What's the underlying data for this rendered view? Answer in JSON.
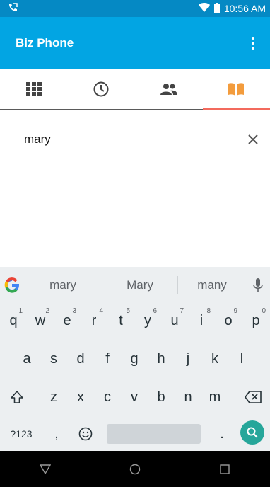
{
  "status": {
    "time": "10:56 AM"
  },
  "app": {
    "title": "Biz Phone"
  },
  "tabs": [
    {
      "icon": "dialpad-icon"
    },
    {
      "icon": "recent-clock-icon"
    },
    {
      "icon": "contacts-icon"
    },
    {
      "icon": "phonebook-icon",
      "active": true,
      "active_color": "#F36A5D"
    }
  ],
  "search": {
    "value": "mary"
  },
  "keyboard": {
    "suggestions": [
      "mary",
      "Mary",
      "many"
    ],
    "row1": [
      {
        "k": "q",
        "h": "1"
      },
      {
        "k": "w",
        "h": "2"
      },
      {
        "k": "e",
        "h": "3"
      },
      {
        "k": "r",
        "h": "4"
      },
      {
        "k": "t",
        "h": "5"
      },
      {
        "k": "y",
        "h": "6"
      },
      {
        "k": "u",
        "h": "7"
      },
      {
        "k": "i",
        "h": "8"
      },
      {
        "k": "o",
        "h": "9"
      },
      {
        "k": "p",
        "h": "0"
      }
    ],
    "row2": [
      "a",
      "s",
      "d",
      "f",
      "g",
      "h",
      "j",
      "k",
      "l"
    ],
    "row3": [
      "z",
      "x",
      "c",
      "v",
      "b",
      "n",
      "m"
    ],
    "symbols": "?123",
    "comma": ",",
    "period": "."
  },
  "colors": {
    "statusbar": "#0589C4",
    "appbar": "#02A5E3",
    "accent": "#F36A5D",
    "search_key": "#26A69A"
  }
}
